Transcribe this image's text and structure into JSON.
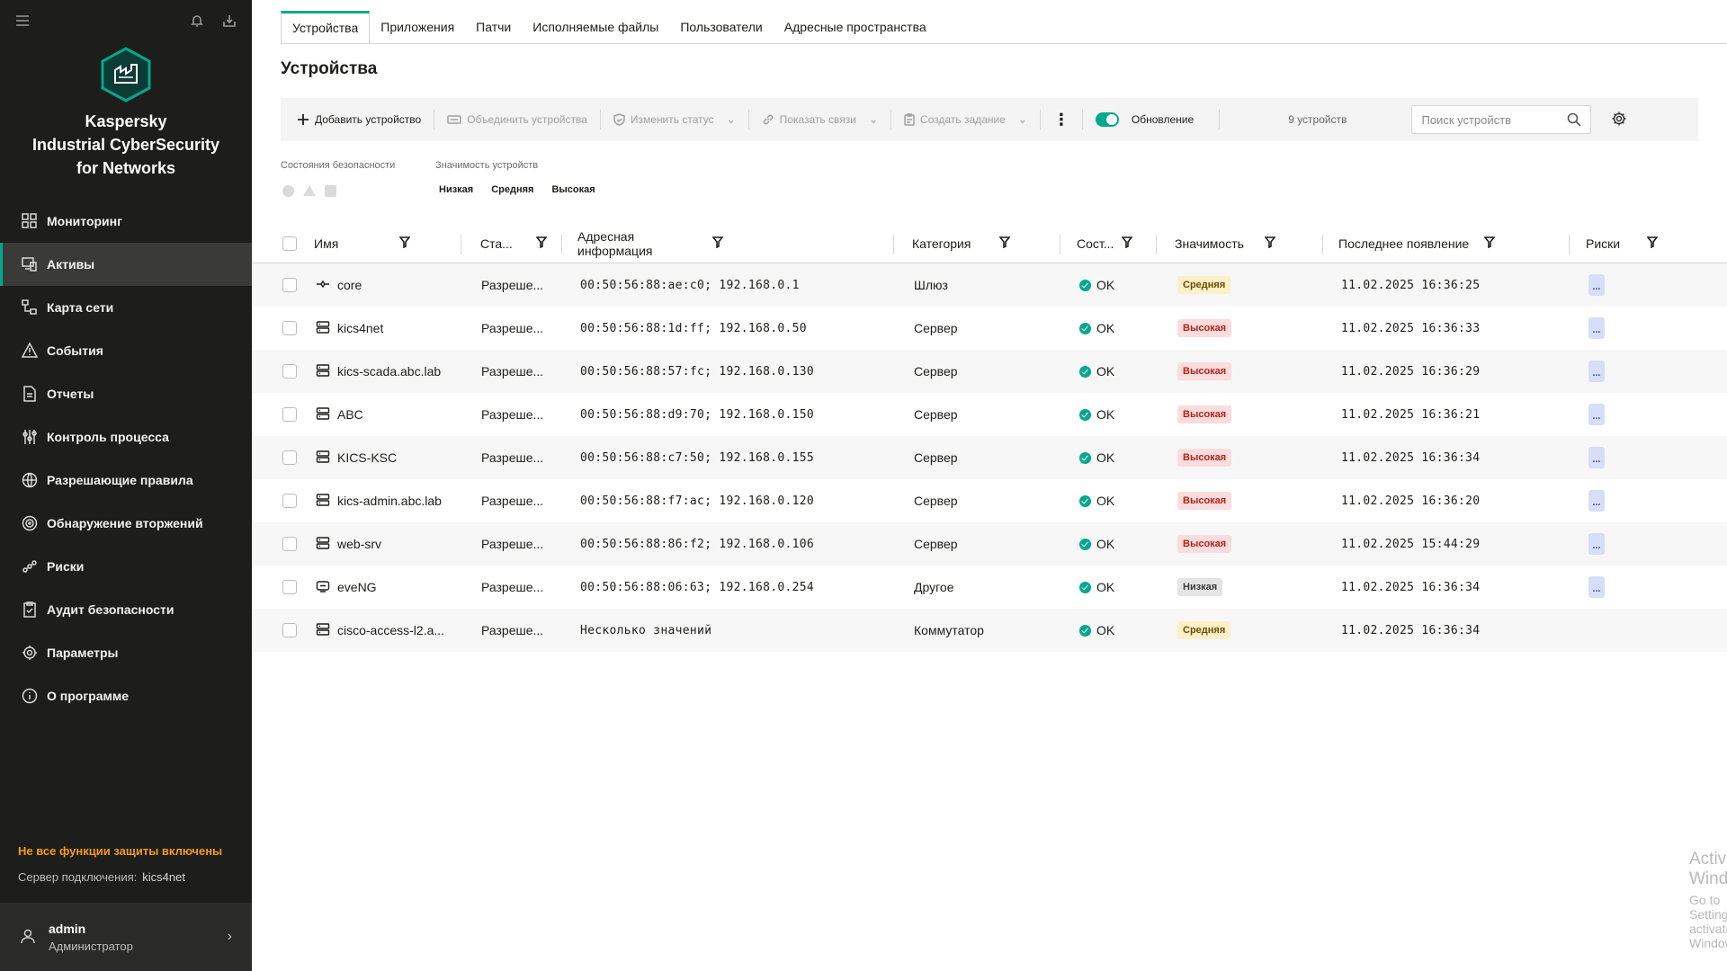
{
  "sidebar": {
    "product_name_line1": "Kaspersky",
    "product_name_line2": "Industrial CyberSecurity",
    "product_name_line3": "for Networks",
    "nav": [
      {
        "label": "Мониторинг",
        "icon": "monitoring-icon"
      },
      {
        "label": "Активы",
        "icon": "assets-icon",
        "active": true
      },
      {
        "label": "Карта сети",
        "icon": "network-map-icon"
      },
      {
        "label": "События",
        "icon": "warning-icon"
      },
      {
        "label": "Отчеты",
        "icon": "report-icon"
      },
      {
        "label": "Контроль процесса",
        "icon": "process-control-icon"
      },
      {
        "label": "Разрешающие правила",
        "icon": "globe-icon"
      },
      {
        "label": "Обнаружение вторжений",
        "icon": "intrusion-icon"
      },
      {
        "label": "Риски",
        "icon": "risks-icon"
      },
      {
        "label": "Аудит безопасности",
        "icon": "audit-icon"
      },
      {
        "label": "Параметры",
        "icon": "gear-icon"
      },
      {
        "label": "О программе",
        "icon": "info-icon"
      }
    ],
    "warning": "Не все функции защиты включены",
    "server_label": "Сервер подключения:",
    "server_value": "kics4net",
    "user_name": "admin",
    "user_role": "Администратор"
  },
  "tabs": [
    "Устройства",
    "Приложения",
    "Патчи",
    "Исполняемые файлы",
    "Пользователи",
    "Адресные пространства"
  ],
  "page_title": "Устройства",
  "toolbar": {
    "add": "Добавить устройство",
    "merge": "Объединить устройства",
    "status": "Изменить статус",
    "links": "Показать связи",
    "task": "Создать задание",
    "refresh": "Обновление",
    "count": "9 устройств",
    "search_placeholder": "Поиск устройств"
  },
  "filters": {
    "security_label": "Состояния безопасности",
    "importance_label": "Значимость устройств",
    "importance_options": [
      "Низкая",
      "Средняя",
      "Высокая"
    ]
  },
  "columns": {
    "name": "Имя",
    "status": "Ста...",
    "address": "Адресная информация",
    "category": "Категория",
    "state": "Сост...",
    "importance": "Значимость",
    "last_seen": "Последнее появление",
    "risks": "Риски"
  },
  "rows": [
    {
      "name": "core",
      "icon": "gateway-icon",
      "status": "Разреше...",
      "address": "00:50:56:88:ae:c0; 192.168.0.1",
      "category": "Шлюз",
      "state": "OK",
      "importance": "Средняя",
      "last_seen": "11.02.2025 16:36:25",
      "risk": "..."
    },
    {
      "name": "kics4net",
      "icon": "server-icon",
      "status": "Разреше...",
      "address": "00:50:56:88:1d:ff; 192.168.0.50",
      "category": "Сервер",
      "state": "OK",
      "importance": "Высокая",
      "last_seen": "11.02.2025 16:36:33",
      "risk": "..."
    },
    {
      "name": "kics-scada.abc.lab",
      "icon": "server-icon",
      "status": "Разреше...",
      "address": "00:50:56:88:57:fc; 192.168.0.130",
      "category": "Сервер",
      "state": "OK",
      "importance": "Высокая",
      "last_seen": "11.02.2025 16:36:29",
      "risk": "..."
    },
    {
      "name": "ABC",
      "icon": "server-icon",
      "status": "Разреше...",
      "address": "00:50:56:88:d9:70; 192.168.0.150",
      "category": "Сервер",
      "state": "OK",
      "importance": "Высокая",
      "last_seen": "11.02.2025 16:36:21",
      "risk": "..."
    },
    {
      "name": "KICS-KSC",
      "icon": "server-icon",
      "status": "Разреше...",
      "address": "00:50:56:88:c7:50; 192.168.0.155",
      "category": "Сервер",
      "state": "OK",
      "importance": "Высокая",
      "last_seen": "11.02.2025 16:36:34",
      "risk": "..."
    },
    {
      "name": "kics-admin.abc.lab",
      "icon": "server-icon",
      "status": "Разреше...",
      "address": "00:50:56:88:f7:ac; 192.168.0.120",
      "category": "Сервер",
      "state": "OK",
      "importance": "Высокая",
      "last_seen": "11.02.2025 16:36:20",
      "risk": "..."
    },
    {
      "name": "web-srv",
      "icon": "server-icon",
      "status": "Разреше...",
      "address": "00:50:56:88:86:f2; 192.168.0.106",
      "category": "Сервер",
      "state": "OK",
      "importance": "Высокая",
      "last_seen": "11.02.2025 15:44:29",
      "risk": "..."
    },
    {
      "name": "eveNG",
      "icon": "other-device-icon",
      "status": "Разреше...",
      "address": "00:50:56:88:06:63; 192.168.0.254",
      "category": "Другое",
      "state": "OK",
      "importance": "Низкая",
      "last_seen": "11.02.2025 16:36:34",
      "risk": "..."
    },
    {
      "name": "cisco-access-l2.a...",
      "icon": "switch-icon",
      "status": "Разреше...",
      "address": "Несколько значений",
      "category": "Коммутатор",
      "state": "OK",
      "importance": "Средняя",
      "last_seen": "11.02.2025 16:36:34",
      "risk": ""
    }
  ],
  "importance_colors": {
    "Высокая": {
      "bg": "#fcdcdc",
      "fg": "#b3261e"
    },
    "Средняя": {
      "bg": "#fdefc8",
      "fg": "#6b4e00"
    },
    "Низкая": {
      "bg": "#e4e4e4",
      "fg": "#3b3b3b"
    }
  },
  "watermark": {
    "line1": "Activate Windows",
    "line2": "Go to Settings to activate Windows."
  }
}
